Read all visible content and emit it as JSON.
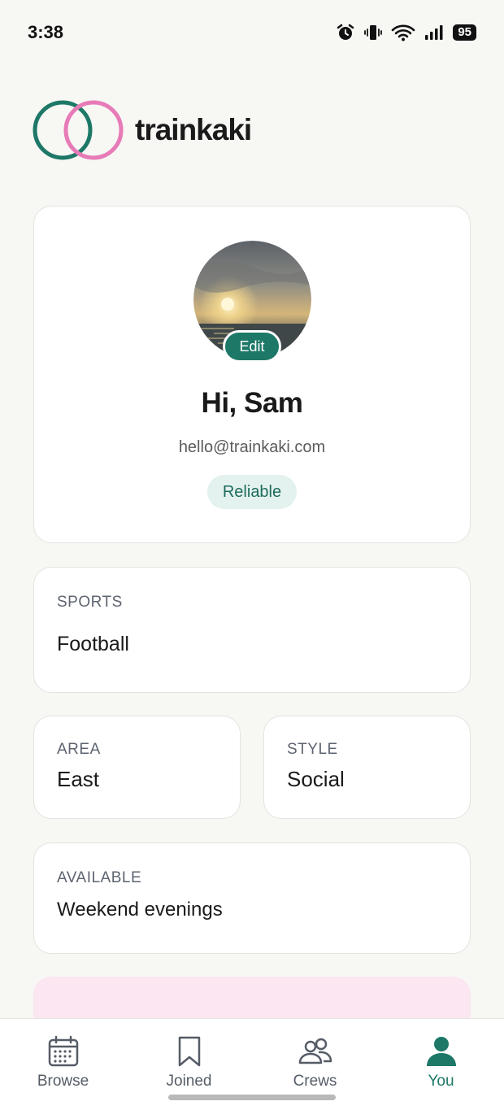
{
  "status_bar": {
    "time": "3:38",
    "battery": "95",
    "icons": [
      "alarm-icon",
      "vibrate-icon",
      "wifi-icon",
      "signal-icon",
      "battery-icon"
    ]
  },
  "brand": {
    "name": "trainkaki",
    "colors": {
      "teal": "#1d7867",
      "pink": "#e77bb7"
    }
  },
  "profile": {
    "edit_label": "Edit",
    "greeting": "Hi, Sam",
    "email": "hello@trainkaki.com",
    "badge": "Reliable"
  },
  "details": {
    "sports": {
      "label": "SPORTS",
      "value": "Football"
    },
    "area": {
      "label": "AREA",
      "value": "East"
    },
    "style": {
      "label": "STYLE",
      "value": "Social"
    },
    "available": {
      "label": "AVAILABLE",
      "value": "Weekend evenings"
    }
  },
  "nav": {
    "items": [
      {
        "label": "Browse",
        "icon": "calendar-icon",
        "active": false
      },
      {
        "label": "Joined",
        "icon": "bookmark-icon",
        "active": false
      },
      {
        "label": "Crews",
        "icon": "people-icon",
        "active": false
      },
      {
        "label": "You",
        "icon": "person-icon",
        "active": true
      }
    ],
    "active_color": "#1d7867"
  }
}
